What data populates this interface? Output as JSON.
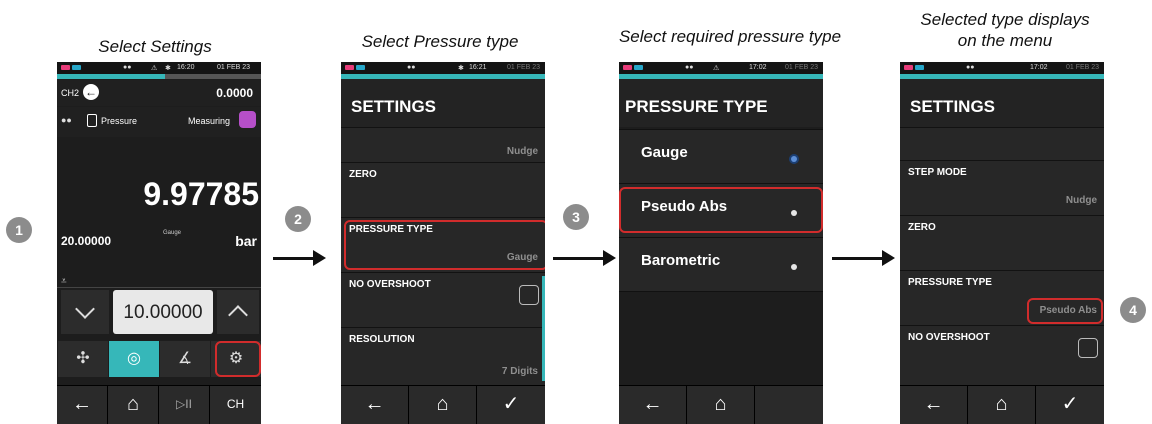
{
  "captions": {
    "step1": "Select Settings",
    "step2": "Select Pressure type",
    "step3": "Select required pressure type",
    "step4_line1": "Selected type displays",
    "step4_line2": "on the menu"
  },
  "badges": [
    "1",
    "2",
    "3",
    "4"
  ],
  "screen1": {
    "status_time": "16:20",
    "status_date": "01 FEB 23",
    "channel": "CH2",
    "top_value": "0.0000",
    "function_label": "Pressure",
    "mode_label": "Measuring",
    "main_reading": "9.97785",
    "range_value": "20.00000",
    "type_small": "Gauge",
    "unit": "bar",
    "setpoint_value": "10.00000",
    "down_symbol": "⌵",
    "up_symbol": "︿",
    "nav": {
      "back": "←",
      "home": "⌂",
      "play": "▷II",
      "channel": "CH"
    }
  },
  "screen2": {
    "status_time": "16:21",
    "status_date": "01 FEB 23",
    "title": "SETTINGS",
    "nudge": "Nudge",
    "zero": "ZERO",
    "pressure_type_label": "PRESSURE TYPE",
    "pressure_type_value": "Gauge",
    "no_overshoot": "NO OVERSHOOT",
    "resolution_label": "RESOLUTION",
    "resolution_value": "7 Digits",
    "nav": {
      "back": "←",
      "home": "⌂",
      "ok": "✓"
    }
  },
  "screen3": {
    "status_time": "17:02",
    "status_date": "01 FEB 23",
    "title": "PRESSURE TYPE",
    "options": [
      "Gauge",
      "Pseudo Abs",
      "Barometric"
    ],
    "nav": {
      "back": "←",
      "home": "⌂"
    }
  },
  "screen4": {
    "status_time": "17:02",
    "status_date": "01 FEB 23",
    "title": "SETTINGS",
    "step_mode_label": "STEP MODE",
    "step_mode_value": "Nudge",
    "zero": "ZERO",
    "pressure_type_label": "PRESSURE TYPE",
    "pressure_type_value": "Pseudo Abs",
    "no_overshoot": "NO OVERSHOOT",
    "nav": {
      "back": "←",
      "home": "⌂",
      "ok": "✓"
    }
  },
  "colors": {
    "accent": "#36b7b9",
    "highlight": "#d12c2c",
    "badge": "#8c8c8c"
  }
}
